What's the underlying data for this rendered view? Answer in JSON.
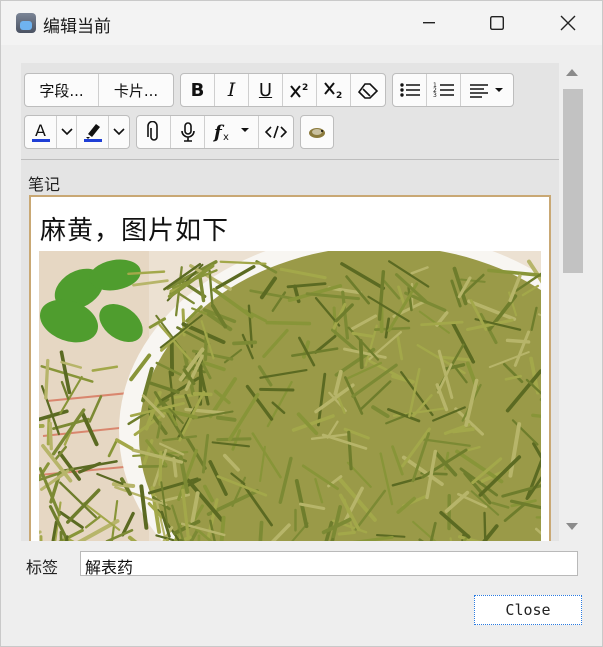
{
  "window": {
    "title": "编辑当前"
  },
  "toolbar": {
    "fields_label": "字段...",
    "cards_label": "卡片...",
    "bold_label": "B",
    "italic_label": "I",
    "underline_label": "U",
    "text_color": "#1f3fd6",
    "highlight_color": "#1f3fd6"
  },
  "editor": {
    "field_name": "笔记",
    "field_text": "麻黄，图片如下",
    "field_border_color": "#c9a874"
  },
  "tags": {
    "label": "标签",
    "value": "解表药"
  },
  "buttons": {
    "close_label": "Close"
  }
}
